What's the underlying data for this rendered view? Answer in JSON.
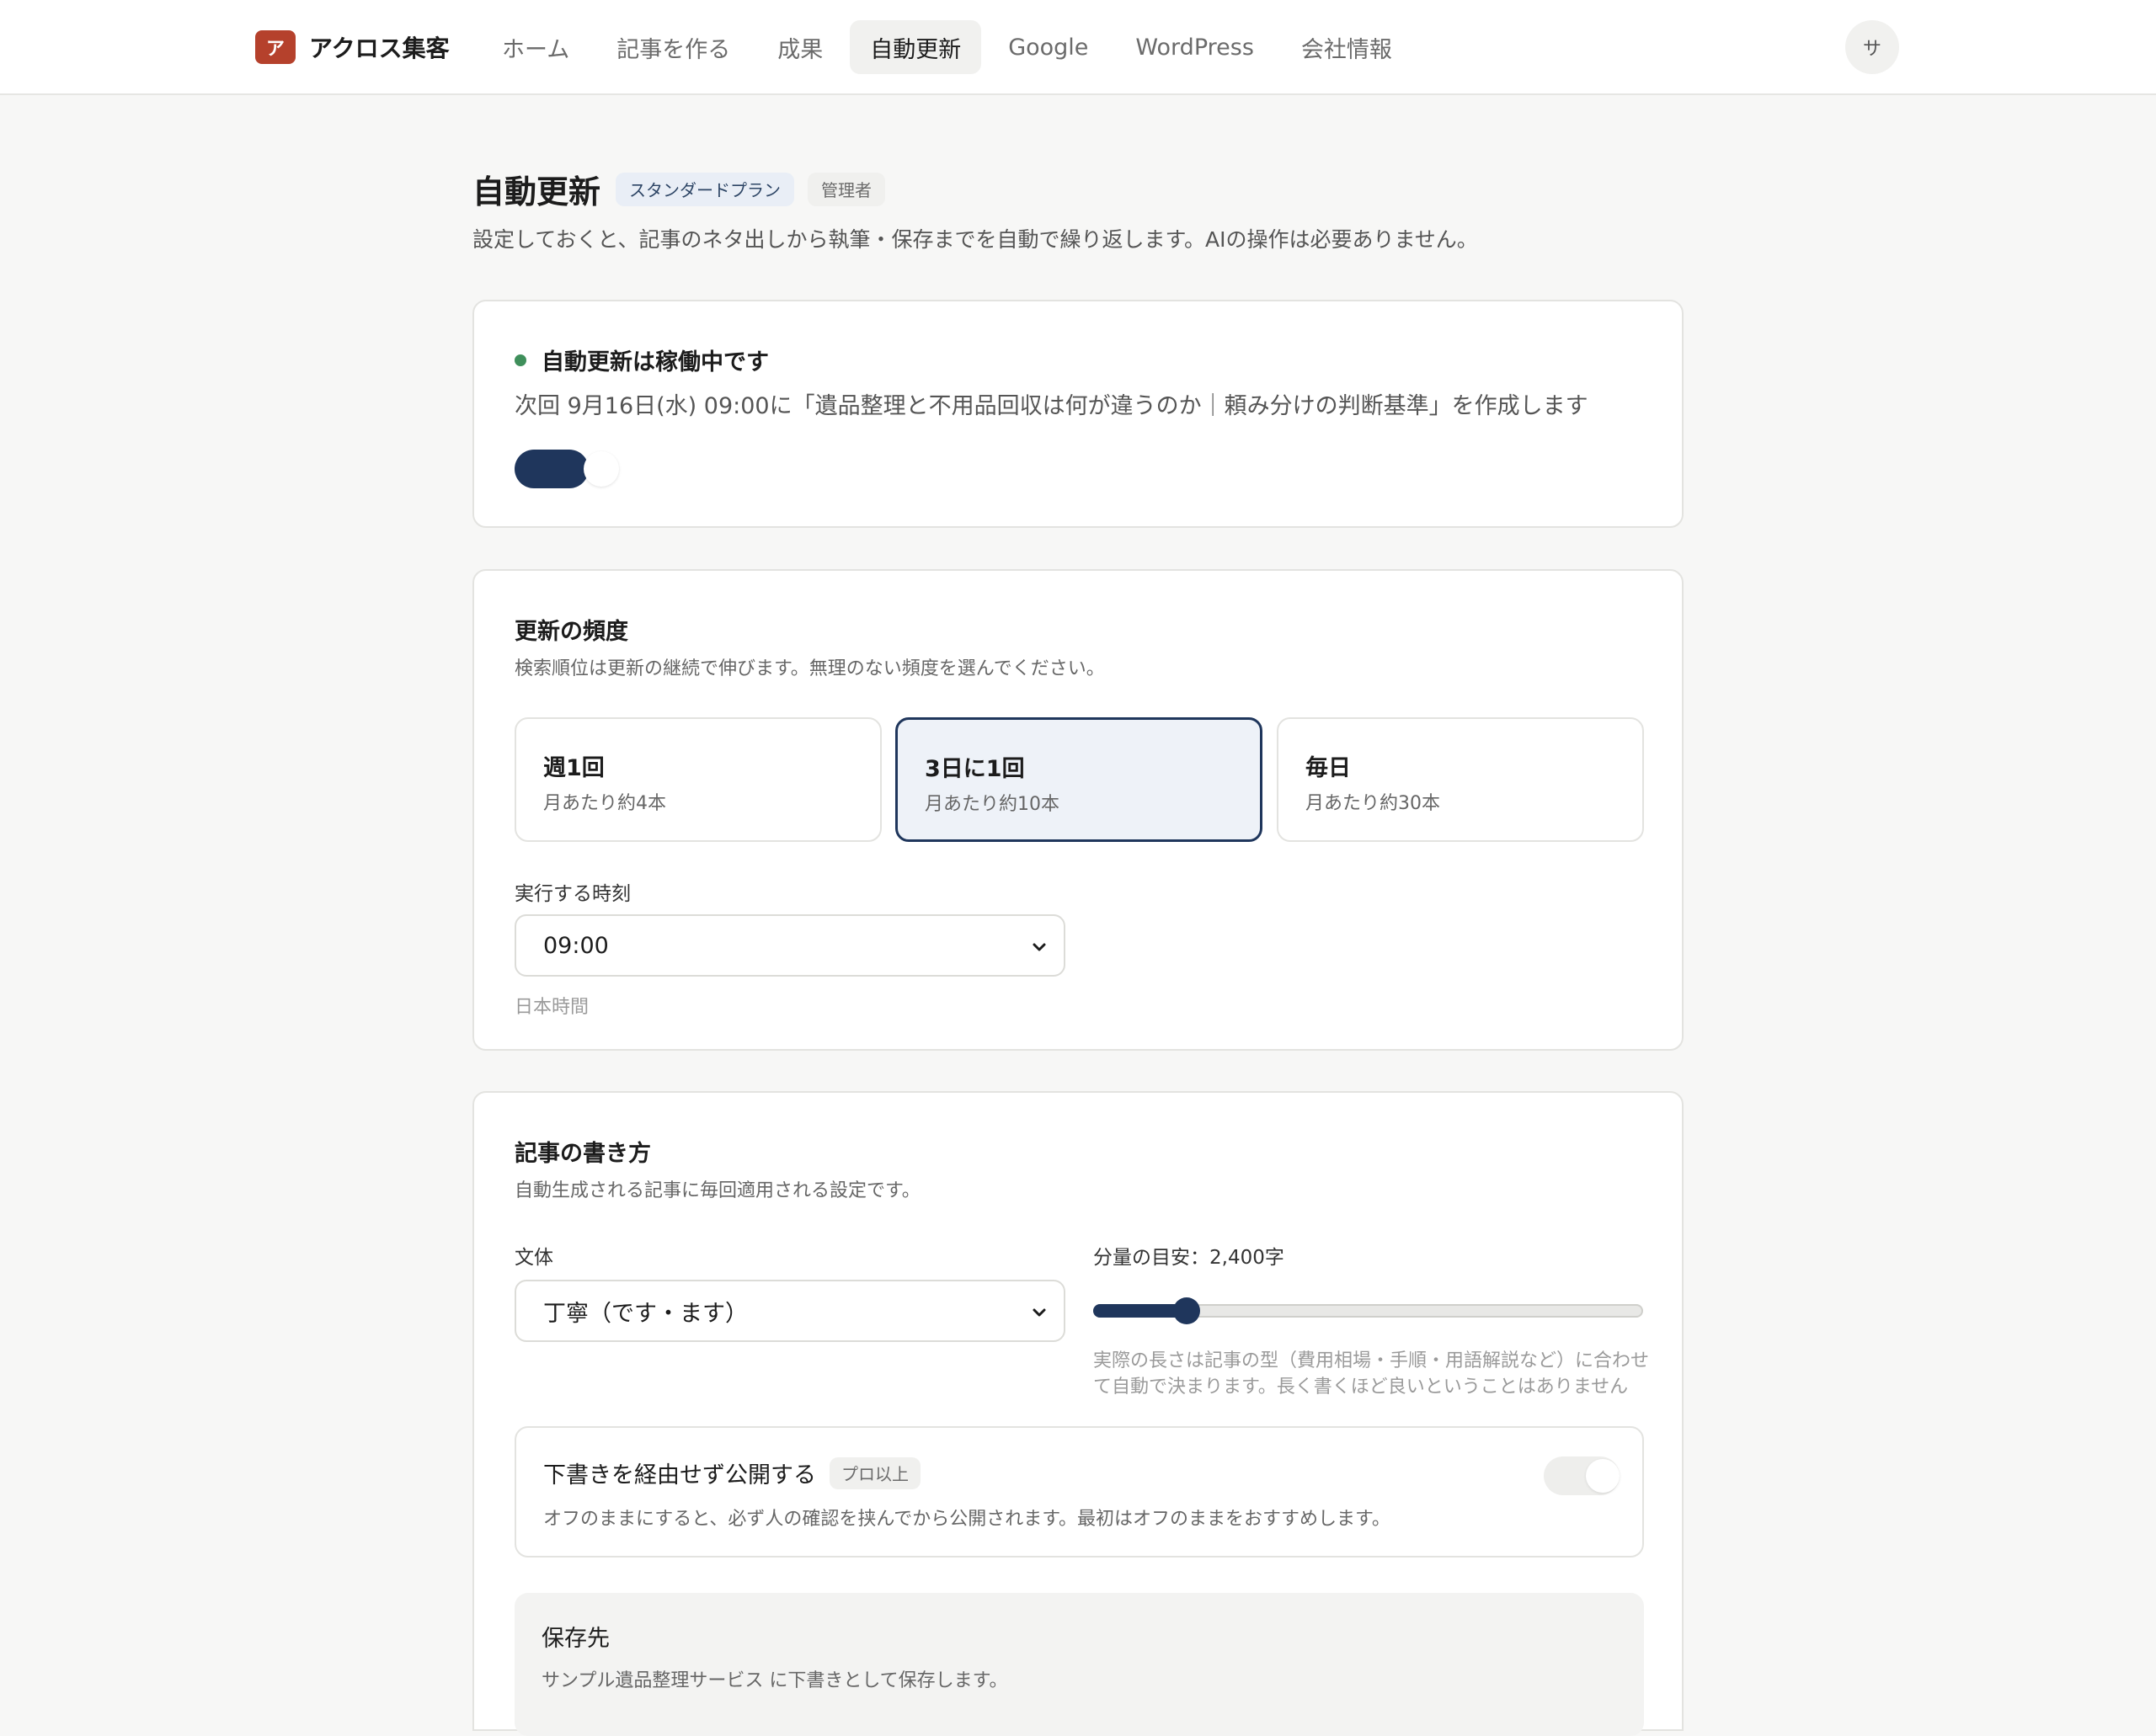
{
  "brand": {
    "mark": "ア",
    "name": "アクロス集客"
  },
  "nav": {
    "items": [
      {
        "label": "ホーム",
        "active": false
      },
      {
        "label": "記事を作る",
        "active": false
      },
      {
        "label": "成果",
        "active": false
      },
      {
        "label": "自動更新",
        "active": true
      },
      {
        "label": "Google",
        "active": false
      },
      {
        "label": "WordPress",
        "active": false
      },
      {
        "label": "会社情報",
        "active": false
      }
    ],
    "avatar": "サ"
  },
  "header": {
    "title": "自動更新",
    "plan_badge": "スタンダードプラン",
    "role_badge": "管理者",
    "description": "設定しておくと、記事のネタ出しから執筆・保存までを自動で繰り返します。AIの操作は必要ありません。"
  },
  "status": {
    "label": "自動更新は稼働中です",
    "next_run": "次回 9月16日(水) 09:00に「遺品整理と不用品回収は何が違うのか｜頼み分けの判断基準」を作成します",
    "enabled": true
  },
  "frequency": {
    "title": "更新の頻度",
    "subtitle": "検索順位は更新の継続で伸びます。無理のない頻度を選んでください。",
    "options": [
      {
        "name": "週1回",
        "detail": "月あたり約4本",
        "selected": false
      },
      {
        "name": "3日に1回",
        "detail": "月あたり約10本",
        "selected": true
      },
      {
        "name": "毎日",
        "detail": "月あたり約30本",
        "selected": false
      }
    ],
    "time_label": "実行する時刻",
    "time_value": "09:00",
    "time_hint": "日本時間"
  },
  "writing": {
    "title": "記事の書き方",
    "subtitle": "自動生成される記事に毎回適用される設定です。",
    "style_label": "文体",
    "style_value": "丁寧（です・ます）",
    "length_label": "分量の目安：2,400字",
    "length_fraction": 0.17,
    "length_help_1": "実際の長さは記事の型（費用相場・手順・用語解説など）に合わせ",
    "length_help_2": "て自動で決まります。長く書くほど良いということはありません",
    "publish_title": "下書きを経由せず公開する",
    "publish_badge": "プロ以上",
    "publish_desc": "オフのままにすると、必ず人の確認を挟んでから公開されます。最初はオフのままをおすすめします。",
    "publish_enabled": false,
    "save_title": "保存先",
    "save_desc": "サンプル遺品整理サービス に下書きとして保存します。"
  },
  "colors": {
    "accent": "#1f365c",
    "brand": "#b5412c",
    "status_ok": "#3f8f5b"
  }
}
